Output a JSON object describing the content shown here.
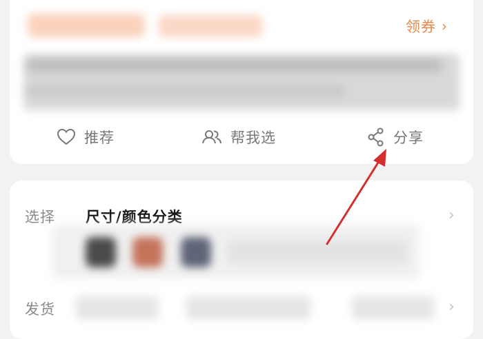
{
  "coupon": {
    "label": "领券",
    "chevron": "›"
  },
  "actions": {
    "recommend": "推荐",
    "help_choose": "帮我选",
    "share": "分享"
  },
  "options": {
    "select_label": "选择",
    "select_value": "尺寸/颜色分类",
    "ship_label": "发货",
    "chevron": "›"
  },
  "icons": {
    "recommend": "heart-icon",
    "help_choose": "people-icon",
    "share": "share-icon",
    "coupon": "chevron-right-icon"
  },
  "colors": {
    "accent": "#e58a4a",
    "annotation_arrow": "#d32f2f"
  }
}
